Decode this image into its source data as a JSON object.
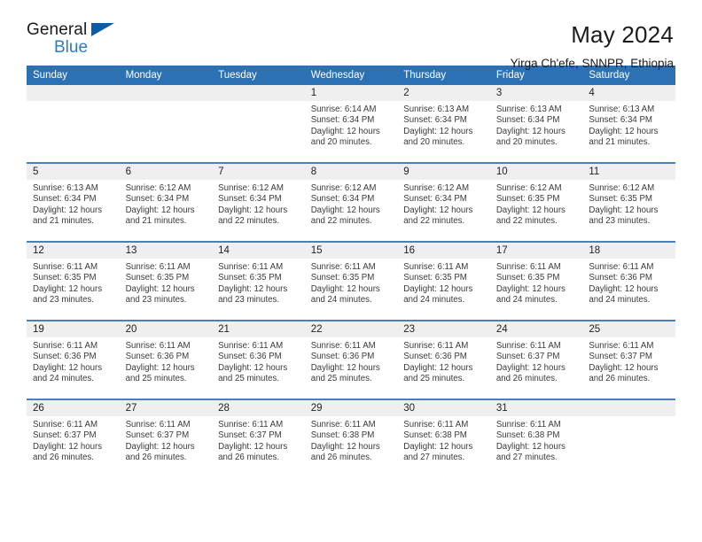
{
  "brand": {
    "name_top": "General",
    "name_bottom": "Blue",
    "accent_color": "#2b7cc4",
    "triangle_color": "#0a5ca8"
  },
  "header": {
    "title": "May 2024",
    "subtitle": "Yirga Ch'efe, SNNPR, Ethiopia"
  },
  "theme": {
    "header_row_bg": "#2d71b5",
    "header_row_text": "#ffffff",
    "daynum_band_bg": "#efefef",
    "row_separator": "#4a7fbd",
    "body_text": "#3a3a3a"
  },
  "calendar": {
    "weekday_headers": [
      "Sunday",
      "Monday",
      "Tuesday",
      "Wednesday",
      "Thursday",
      "Friday",
      "Saturday"
    ],
    "weeks": [
      [
        {
          "day": "",
          "lines": []
        },
        {
          "day": "",
          "lines": []
        },
        {
          "day": "",
          "lines": []
        },
        {
          "day": "1",
          "lines": [
            "Sunrise: 6:14 AM",
            "Sunset: 6:34 PM",
            "Daylight: 12 hours",
            "and 20 minutes."
          ]
        },
        {
          "day": "2",
          "lines": [
            "Sunrise: 6:13 AM",
            "Sunset: 6:34 PM",
            "Daylight: 12 hours",
            "and 20 minutes."
          ]
        },
        {
          "day": "3",
          "lines": [
            "Sunrise: 6:13 AM",
            "Sunset: 6:34 PM",
            "Daylight: 12 hours",
            "and 20 minutes."
          ]
        },
        {
          "day": "4",
          "lines": [
            "Sunrise: 6:13 AM",
            "Sunset: 6:34 PM",
            "Daylight: 12 hours",
            "and 21 minutes."
          ]
        }
      ],
      [
        {
          "day": "5",
          "lines": [
            "Sunrise: 6:13 AM",
            "Sunset: 6:34 PM",
            "Daylight: 12 hours",
            "and 21 minutes."
          ]
        },
        {
          "day": "6",
          "lines": [
            "Sunrise: 6:12 AM",
            "Sunset: 6:34 PM",
            "Daylight: 12 hours",
            "and 21 minutes."
          ]
        },
        {
          "day": "7",
          "lines": [
            "Sunrise: 6:12 AM",
            "Sunset: 6:34 PM",
            "Daylight: 12 hours",
            "and 22 minutes."
          ]
        },
        {
          "day": "8",
          "lines": [
            "Sunrise: 6:12 AM",
            "Sunset: 6:34 PM",
            "Daylight: 12 hours",
            "and 22 minutes."
          ]
        },
        {
          "day": "9",
          "lines": [
            "Sunrise: 6:12 AM",
            "Sunset: 6:34 PM",
            "Daylight: 12 hours",
            "and 22 minutes."
          ]
        },
        {
          "day": "10",
          "lines": [
            "Sunrise: 6:12 AM",
            "Sunset: 6:35 PM",
            "Daylight: 12 hours",
            "and 22 minutes."
          ]
        },
        {
          "day": "11",
          "lines": [
            "Sunrise: 6:12 AM",
            "Sunset: 6:35 PM",
            "Daylight: 12 hours",
            "and 23 minutes."
          ]
        }
      ],
      [
        {
          "day": "12",
          "lines": [
            "Sunrise: 6:11 AM",
            "Sunset: 6:35 PM",
            "Daylight: 12 hours",
            "and 23 minutes."
          ]
        },
        {
          "day": "13",
          "lines": [
            "Sunrise: 6:11 AM",
            "Sunset: 6:35 PM",
            "Daylight: 12 hours",
            "and 23 minutes."
          ]
        },
        {
          "day": "14",
          "lines": [
            "Sunrise: 6:11 AM",
            "Sunset: 6:35 PM",
            "Daylight: 12 hours",
            "and 23 minutes."
          ]
        },
        {
          "day": "15",
          "lines": [
            "Sunrise: 6:11 AM",
            "Sunset: 6:35 PM",
            "Daylight: 12 hours",
            "and 24 minutes."
          ]
        },
        {
          "day": "16",
          "lines": [
            "Sunrise: 6:11 AM",
            "Sunset: 6:35 PM",
            "Daylight: 12 hours",
            "and 24 minutes."
          ]
        },
        {
          "day": "17",
          "lines": [
            "Sunrise: 6:11 AM",
            "Sunset: 6:35 PM",
            "Daylight: 12 hours",
            "and 24 minutes."
          ]
        },
        {
          "day": "18",
          "lines": [
            "Sunrise: 6:11 AM",
            "Sunset: 6:36 PM",
            "Daylight: 12 hours",
            "and 24 minutes."
          ]
        }
      ],
      [
        {
          "day": "19",
          "lines": [
            "Sunrise: 6:11 AM",
            "Sunset: 6:36 PM",
            "Daylight: 12 hours",
            "and 24 minutes."
          ]
        },
        {
          "day": "20",
          "lines": [
            "Sunrise: 6:11 AM",
            "Sunset: 6:36 PM",
            "Daylight: 12 hours",
            "and 25 minutes."
          ]
        },
        {
          "day": "21",
          "lines": [
            "Sunrise: 6:11 AM",
            "Sunset: 6:36 PM",
            "Daylight: 12 hours",
            "and 25 minutes."
          ]
        },
        {
          "day": "22",
          "lines": [
            "Sunrise: 6:11 AM",
            "Sunset: 6:36 PM",
            "Daylight: 12 hours",
            "and 25 minutes."
          ]
        },
        {
          "day": "23",
          "lines": [
            "Sunrise: 6:11 AM",
            "Sunset: 6:36 PM",
            "Daylight: 12 hours",
            "and 25 minutes."
          ]
        },
        {
          "day": "24",
          "lines": [
            "Sunrise: 6:11 AM",
            "Sunset: 6:37 PM",
            "Daylight: 12 hours",
            "and 26 minutes."
          ]
        },
        {
          "day": "25",
          "lines": [
            "Sunrise: 6:11 AM",
            "Sunset: 6:37 PM",
            "Daylight: 12 hours",
            "and 26 minutes."
          ]
        }
      ],
      [
        {
          "day": "26",
          "lines": [
            "Sunrise: 6:11 AM",
            "Sunset: 6:37 PM",
            "Daylight: 12 hours",
            "and 26 minutes."
          ]
        },
        {
          "day": "27",
          "lines": [
            "Sunrise: 6:11 AM",
            "Sunset: 6:37 PM",
            "Daylight: 12 hours",
            "and 26 minutes."
          ]
        },
        {
          "day": "28",
          "lines": [
            "Sunrise: 6:11 AM",
            "Sunset: 6:37 PM",
            "Daylight: 12 hours",
            "and 26 minutes."
          ]
        },
        {
          "day": "29",
          "lines": [
            "Sunrise: 6:11 AM",
            "Sunset: 6:38 PM",
            "Daylight: 12 hours",
            "and 26 minutes."
          ]
        },
        {
          "day": "30",
          "lines": [
            "Sunrise: 6:11 AM",
            "Sunset: 6:38 PM",
            "Daylight: 12 hours",
            "and 27 minutes."
          ]
        },
        {
          "day": "31",
          "lines": [
            "Sunrise: 6:11 AM",
            "Sunset: 6:38 PM",
            "Daylight: 12 hours",
            "and 27 minutes."
          ]
        },
        {
          "day": "",
          "lines": []
        }
      ]
    ]
  }
}
